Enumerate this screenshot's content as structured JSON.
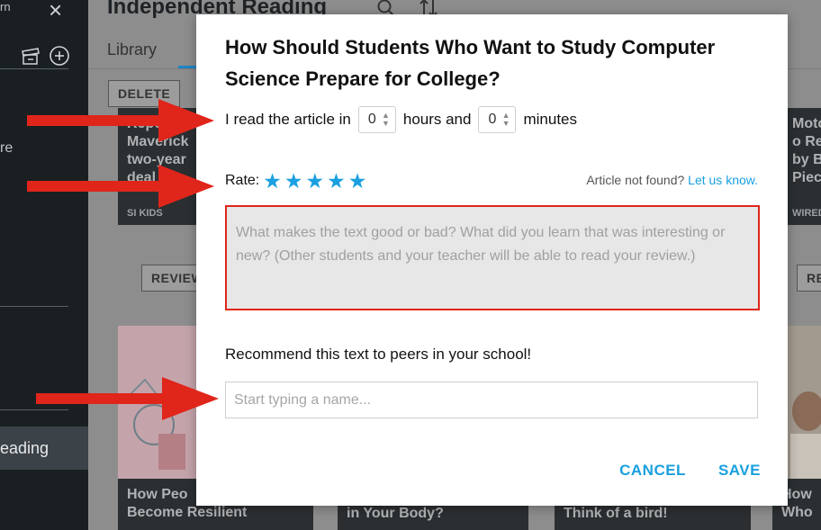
{
  "sidebar": {
    "top_text": "rn",
    "close_icon": "×",
    "partial_text": "re",
    "active_item": "eading"
  },
  "main": {
    "title": "Independent Reading",
    "tab": "Library",
    "delete_label": "DELETE",
    "review_label": "REVIEW",
    "review_label_right": "RE",
    "cards": [
      {
        "text": "Repo\nMaverick\ntwo-year\ndeal",
        "source": "SI KIDS"
      },
      {
        "text": "Moto\no Re\nby Br\nPiece",
        "source": "WIRED"
      },
      {
        "text": "How Peo\nBecome Resilient",
        "source": ""
      },
      {
        "text": "in Your Body?",
        "source": ""
      },
      {
        "text": "Think of a bird!",
        "source": ""
      },
      {
        "text": "How\nWho",
        "source": ""
      }
    ]
  },
  "modal": {
    "title": "How Should Students Who Want to Study Computer Science Prepare for College?",
    "time_prefix": "I read the article in",
    "hours_value": "0",
    "hours_label": "hours and",
    "minutes_value": "0",
    "minutes_label": "minutes",
    "rate_label": "Rate:",
    "star_count": 5,
    "not_found_text": "Article not found?",
    "not_found_link": "Let us know.",
    "review_placeholder": "What makes the text good or bad? What did you learn that was interesting or new? (Other students and your teacher will be able to read your review.)",
    "recommend_label": "Recommend this text to peers in your school!",
    "name_placeholder": "Start typing a name...",
    "cancel_label": "CANCEL",
    "save_label": "SAVE"
  },
  "colors": {
    "accent": "#1aa0e0",
    "arrow": "#e0251b",
    "highlight_border": "#e0251b"
  }
}
